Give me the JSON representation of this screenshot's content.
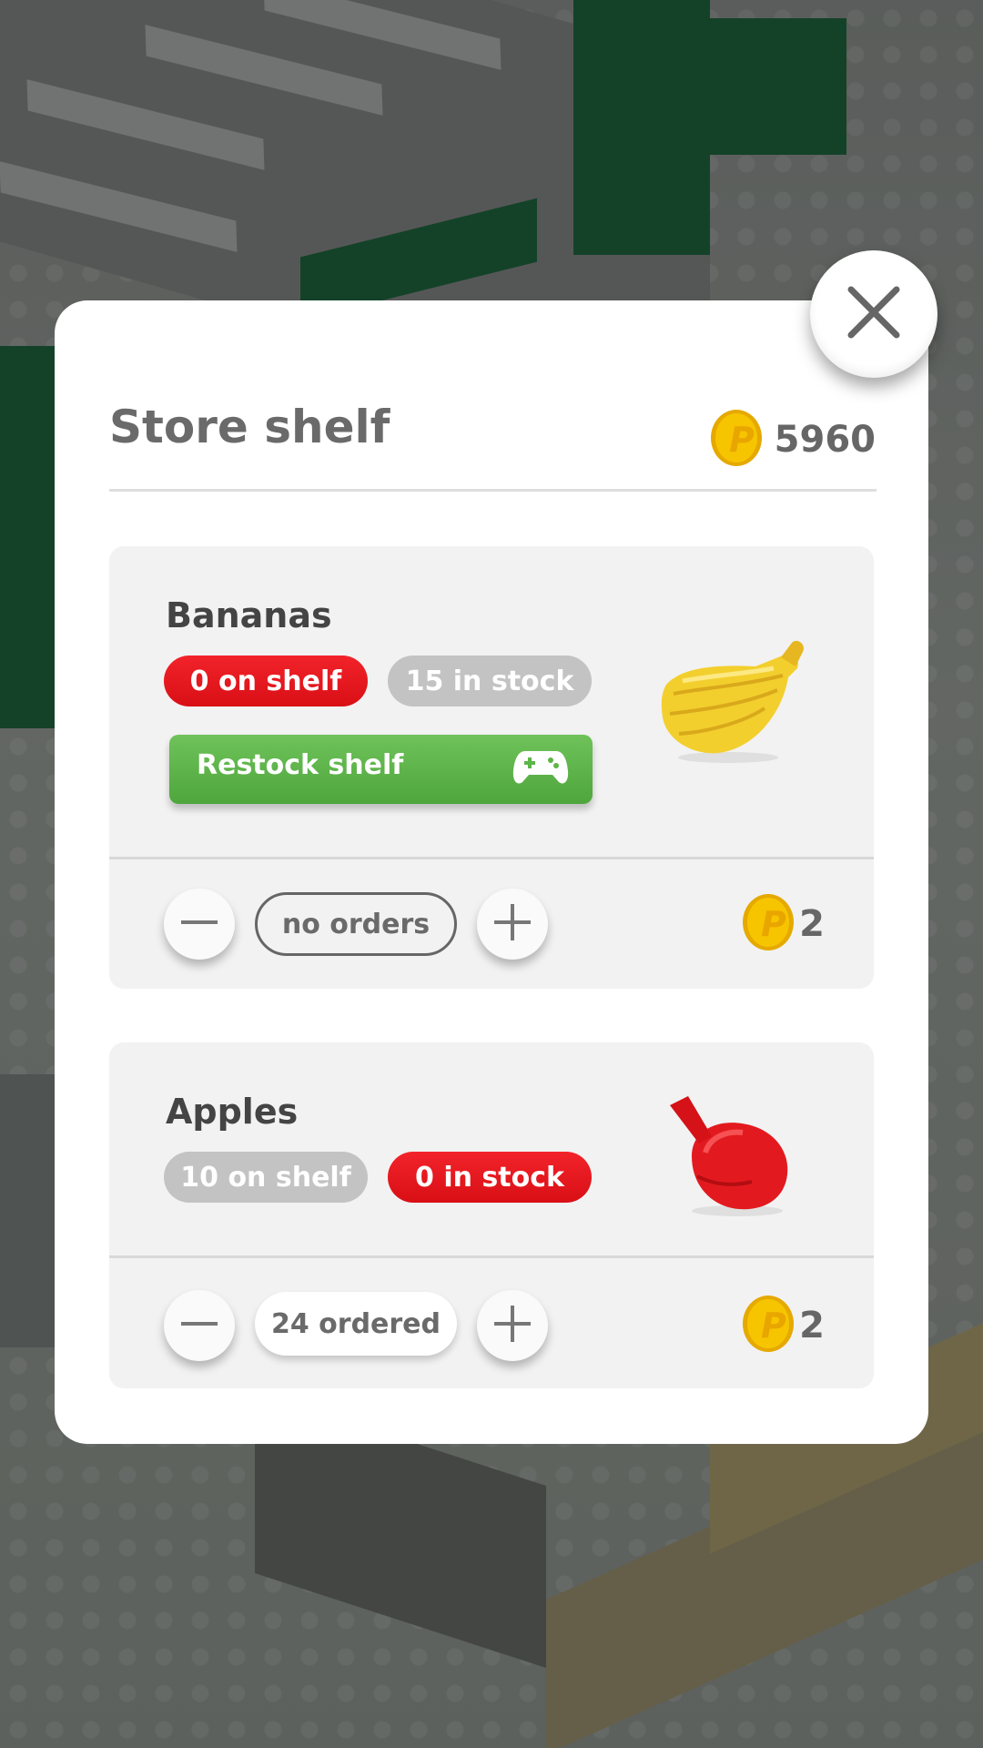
{
  "modal": {
    "title": "Store shelf",
    "coin_balance": "5960",
    "close_icon": "close-x-icon"
  },
  "products": [
    {
      "name": "Bananas",
      "on_shelf": "0 on shelf",
      "in_stock": "15 in stock",
      "on_shelf_status": "empty",
      "in_stock_status": "ok",
      "restock_label": "Restock shelf",
      "restock_icon": "gamepad-icon",
      "order_status": "no orders",
      "price": "2",
      "image_icon": "bananas-icon"
    },
    {
      "name": "Apples",
      "on_shelf": "10 on shelf",
      "in_stock": "0 in stock",
      "on_shelf_status": "ok",
      "in_stock_status": "empty",
      "order_status": "24 ordered",
      "price": "2",
      "image_icon": "apple-icon"
    }
  ],
  "colors": {
    "alert_red": "#e3141b",
    "neutral_grey": "#c3c3c3",
    "restock_green": "#5cb548",
    "coin_gold": "#f7c500"
  }
}
